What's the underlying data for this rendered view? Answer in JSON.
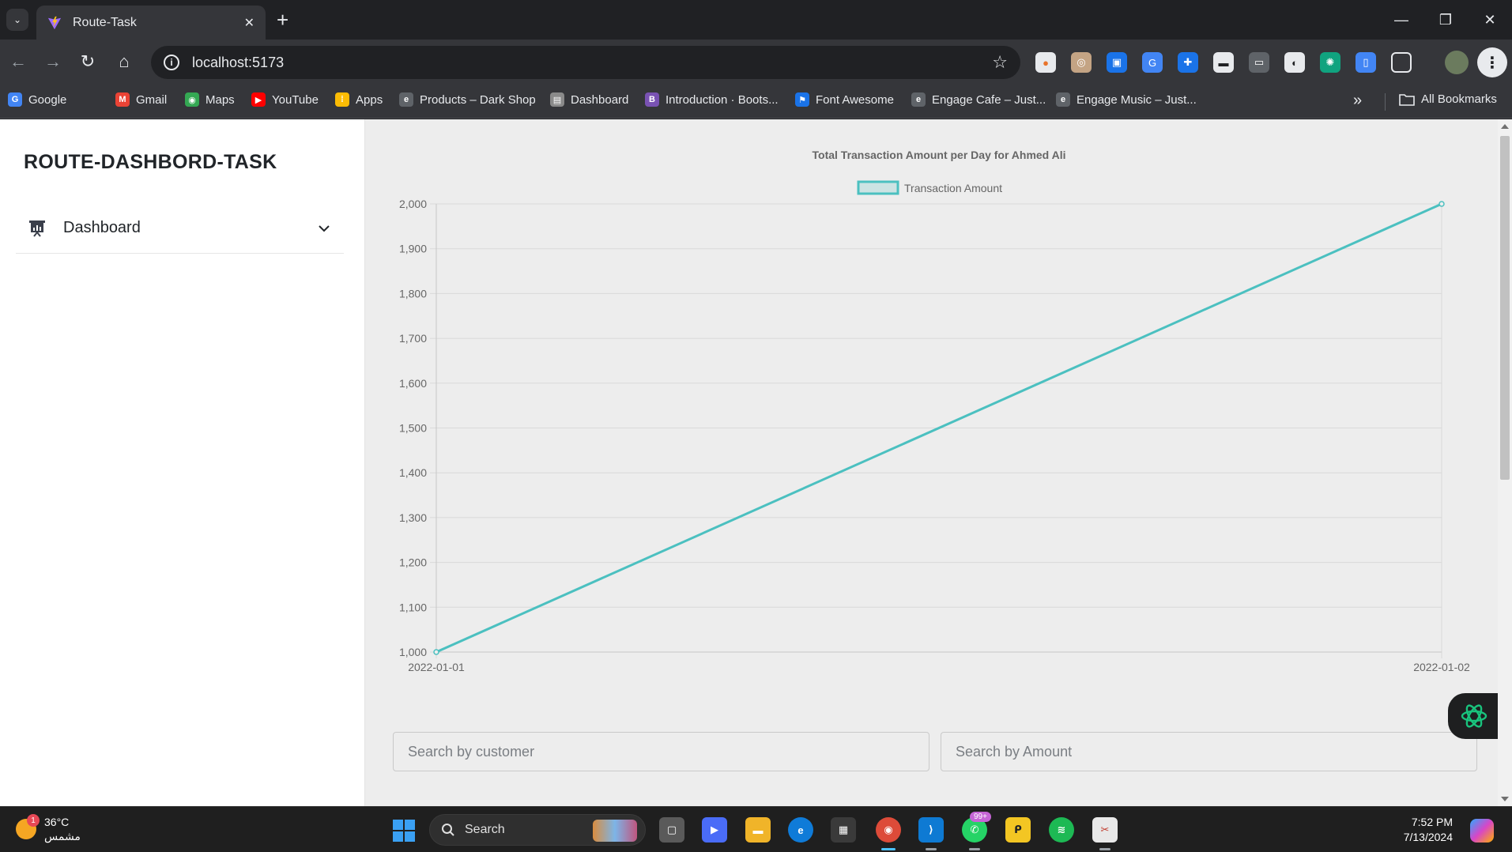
{
  "browser": {
    "tab_title": "Route-Task",
    "url": "localhost:5173",
    "bookmarks": [
      {
        "label": "Google",
        "icon": "google-icon",
        "color": "#4285f4",
        "glyph": "G"
      },
      {
        "label": "Gmail",
        "icon": "gmail-icon",
        "color": "#ea4335",
        "glyph": "M"
      },
      {
        "label": "Maps",
        "icon": "maps-icon",
        "color": "#34a853",
        "glyph": "◉"
      },
      {
        "label": "YouTube",
        "icon": "youtube-icon",
        "color": "#ff0000",
        "glyph": "▶"
      },
      {
        "label": "Apps",
        "icon": "apps-grid-icon",
        "color": "#fbbc05",
        "glyph": "⁞"
      },
      {
        "label": "Products – Dark Shop",
        "icon": "globe-icon",
        "color": "#5f6368",
        "glyph": "e"
      },
      {
        "label": "Dashboard",
        "icon": "page-icon",
        "color": "#8a8a8a",
        "glyph": "▤"
      },
      {
        "label": "Introduction · Boots...",
        "icon": "bootstrap-icon",
        "color": "#7952b3",
        "glyph": "B"
      },
      {
        "label": "Font Awesome",
        "icon": "font-awesome-icon",
        "color": "#1a73e8",
        "glyph": "⚑"
      },
      {
        "label": "Engage Cafe – Just...",
        "icon": "globe-icon",
        "color": "#5f6368",
        "glyph": "e"
      },
      {
        "label": "Engage Music – Just...",
        "icon": "globe-icon",
        "color": "#5f6368",
        "glyph": "e"
      }
    ],
    "all_bookmarks": "All Bookmarks"
  },
  "sidebar": {
    "brand": "ROUTE-DASHBORD-TASK",
    "items": [
      {
        "label": "Dashboard",
        "icon": "presentation-chart-icon"
      }
    ]
  },
  "chart_data": {
    "type": "line",
    "title": "Total Transaction Amount per Day for Ahmed Ali",
    "x": [
      "2022-01-01",
      "2022-01-02"
    ],
    "series": [
      {
        "name": "Transaction Amount",
        "values": [
          1000,
          2000
        ],
        "color": "#4bc0c0"
      }
    ],
    "ylim": [
      1000,
      2000
    ],
    "yticks": [
      "1,000",
      "1,100",
      "1,200",
      "1,300",
      "1,400",
      "1,500",
      "1,600",
      "1,700",
      "1,800",
      "1,900",
      "2,000"
    ],
    "legend": "top-center",
    "grid": true
  },
  "search": {
    "customer_placeholder": "Search by customer",
    "amount_placeholder": "Search by Amount"
  },
  "taskbar": {
    "temperature": "36°C",
    "weather_desc": "مشمس",
    "weather_badge": "1",
    "search_label": "Search",
    "whatsapp_badge": "99+",
    "time": "7:52 PM",
    "date": "7/13/2024"
  }
}
